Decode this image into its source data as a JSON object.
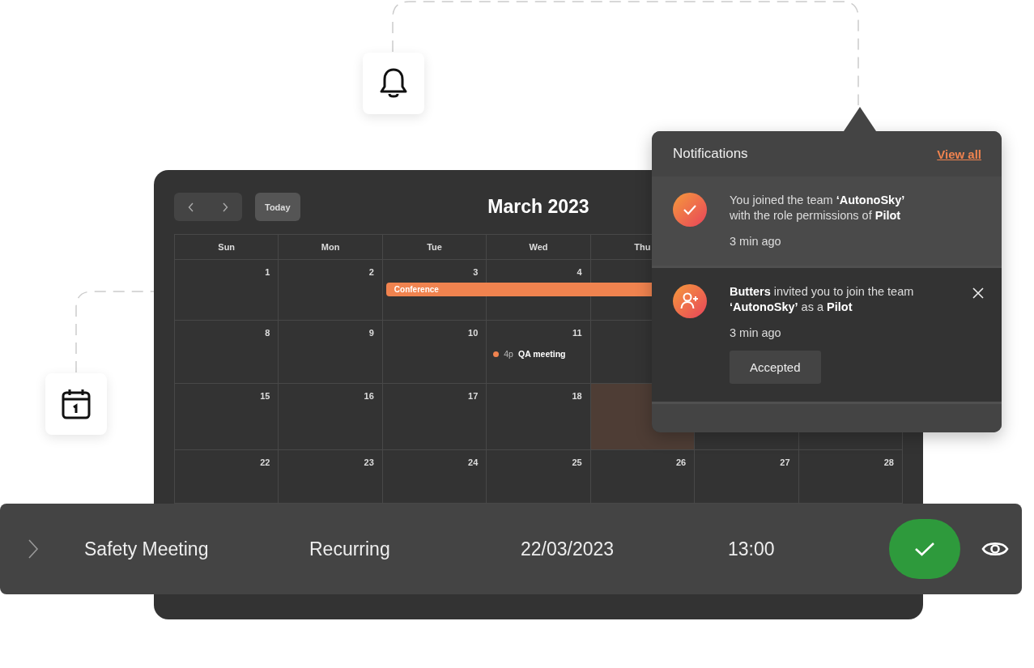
{
  "calendar": {
    "title": "March 2023",
    "today_button": "Today",
    "weekdays": [
      "Sun",
      "Mon",
      "Tue",
      "Wed",
      "Thu"
    ],
    "weeks": [
      [
        {
          "day": "1",
          "highlighted": false
        },
        {
          "day": "2",
          "highlighted": false
        },
        {
          "day": "3",
          "highlighted": false,
          "events": [
            {
              "kind": "multi_day",
              "title": "Conference"
            }
          ]
        },
        {
          "day": "4",
          "highlighted": false
        },
        {
          "highlighted": false
        }
      ],
      [
        {
          "day": "8",
          "highlighted": false
        },
        {
          "day": "9",
          "highlighted": false
        },
        {
          "day": "10",
          "highlighted": false
        },
        {
          "day": "11",
          "highlighted": false,
          "events": [
            {
              "kind": "timed",
              "time": "4p",
              "title": "QA meeting"
            }
          ]
        },
        {
          "highlighted": false
        }
      ],
      [
        {
          "day": "15",
          "highlighted": false
        },
        {
          "day": "16",
          "highlighted": false
        },
        {
          "day": "17",
          "highlighted": false
        },
        {
          "day": "18",
          "highlighted": false
        },
        {
          "highlighted": true
        },
        {
          "highlighted": false
        },
        {
          "highlighted": false
        }
      ],
      [
        {
          "day": "22",
          "highlighted": false
        },
        {
          "day": "23",
          "highlighted": false
        },
        {
          "day": "24",
          "highlighted": false
        },
        {
          "day": "25",
          "highlighted": false
        },
        {
          "day": "26",
          "highlighted": false
        },
        {
          "day": "27",
          "highlighted": false
        },
        {
          "day": "28",
          "highlighted": false
        }
      ]
    ]
  },
  "notifications": {
    "title": "Notifications",
    "view_all": "View all",
    "items": [
      {
        "kind": "joined",
        "unread": true,
        "dismissible": false,
        "message": "You joined the team **‘AutonoSky’**\nwith the role permissions of **Pilot**",
        "time": "3 min ago"
      },
      {
        "kind": "invite",
        "unread": false,
        "dismissible": true,
        "message": "**Butters** invited you to join the team\n**‘AutonoSky’** as a **Pilot**",
        "time": "3 min ago",
        "action": "Accepted"
      }
    ]
  },
  "event_row": {
    "title": "Safety Meeting",
    "recurrence": "Recurring",
    "date": "22/03/2023",
    "time": "13:00",
    "confirmed": true
  }
}
